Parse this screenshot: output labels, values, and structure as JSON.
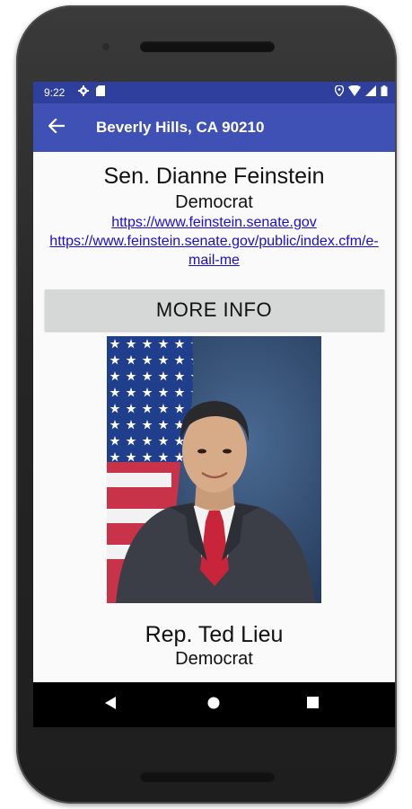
{
  "status_bar": {
    "time": "9:22"
  },
  "app_bar": {
    "title": "Beverly Hills, CA 90210",
    "back_icon": "arrow-left-icon"
  },
  "representatives": [
    {
      "name": "Sen. Dianne Feinstein",
      "party": "Democrat",
      "links": [
        "https://www.feinstein.senate.gov",
        "https://www.feinstein.senate.gov/public/index.cfm/e-mail-me"
      ],
      "more_info_label": "MORE INFO"
    },
    {
      "name": "Rep. Ted Lieu",
      "party": "Democrat"
    }
  ],
  "colors": {
    "status_bar": "#2f3f9e",
    "app_bar": "#3f51b5",
    "link": "#1a0dcc",
    "button": "#d6d8d8"
  },
  "nav_icons": [
    "back-triangle-icon",
    "home-circle-icon",
    "recents-square-icon"
  ]
}
